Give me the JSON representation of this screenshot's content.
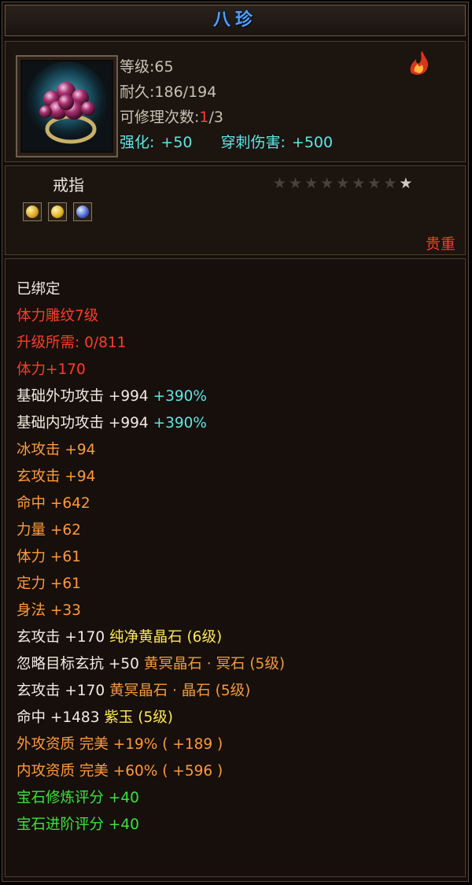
{
  "item": {
    "name": "八珍",
    "level_label": "等级",
    "level_value": ":65",
    "durability_label": "耐久",
    "durability_value": ":186/194",
    "repair_label": "可修理次数",
    "repair_prefix": ":",
    "repair_used": "1",
    "repair_rest": "/3",
    "enhance_label": "强化:",
    "enhance_value": "+50",
    "pierce_label": "穿刺伤害:",
    "pierce_value": "+500",
    "type": "戒指",
    "stars_lit": 1,
    "stars_total": 9,
    "quality": "贵重",
    "badges": [
      "gold-coin",
      "gold-orb",
      "blue-gem"
    ]
  },
  "attributes": [
    {
      "parts": [
        {
          "t": "已绑定",
          "c": "w"
        }
      ]
    },
    {
      "parts": [
        {
          "t": "体力雕纹7级",
          "c": "r"
        }
      ]
    },
    {
      "parts": [
        {
          "t": "升级所需: 0/811",
          "c": "r"
        }
      ]
    },
    {
      "parts": [
        {
          "t": "体力+170",
          "c": "r"
        }
      ]
    },
    {
      "parts": [
        {
          "t": "基础外功攻击 +994 ",
          "c": "w"
        },
        {
          "t": "+390%",
          "c": "c"
        }
      ]
    },
    {
      "parts": [
        {
          "t": "基础内功攻击 +994 ",
          "c": "w"
        },
        {
          "t": "+390%",
          "c": "c"
        }
      ]
    },
    {
      "parts": [
        {
          "t": "冰攻击 +94",
          "c": "o"
        }
      ]
    },
    {
      "parts": [
        {
          "t": "玄攻击 +94",
          "c": "o"
        }
      ]
    },
    {
      "parts": [
        {
          "t": "命中 +642",
          "c": "o"
        }
      ]
    },
    {
      "parts": [
        {
          "t": "力量 +62",
          "c": "o"
        }
      ]
    },
    {
      "parts": [
        {
          "t": "体力 +61",
          "c": "o"
        }
      ]
    },
    {
      "parts": [
        {
          "t": "定力 +61",
          "c": "o"
        }
      ]
    },
    {
      "parts": [
        {
          "t": "身法 +33",
          "c": "o"
        }
      ]
    },
    {
      "parts": [
        {
          "t": "玄攻击 +170 ",
          "c": "w"
        },
        {
          "t": "纯净黄晶石 (6级)",
          "c": "y"
        }
      ]
    },
    {
      "parts": [
        {
          "t": "忽略目标玄抗 +50 ",
          "c": "w"
        },
        {
          "t": "黄冥晶石 · 冥石 (5级)",
          "c": "o2"
        }
      ]
    },
    {
      "parts": [
        {
          "t": "玄攻击 +170 ",
          "c": "w"
        },
        {
          "t": "黄冥晶石 · 晶石 (5级)",
          "c": "o2"
        }
      ]
    },
    {
      "parts": [
        {
          "t": "命中 +1483 ",
          "c": "w"
        },
        {
          "t": "紫玉 (5级)",
          "c": "y"
        }
      ]
    },
    {
      "parts": [
        {
          "t": "外攻资质  完美 +19% ( +189 )",
          "c": "o"
        }
      ]
    },
    {
      "parts": [
        {
          "t": "内攻资质  完美 +60% ( +596 )",
          "c": "o"
        }
      ]
    },
    {
      "parts": [
        {
          "t": "宝石修炼评分 +40",
          "c": "g"
        }
      ]
    },
    {
      "parts": [
        {
          "t": "宝石进阶评分 +40",
          "c": "g"
        }
      ]
    }
  ]
}
